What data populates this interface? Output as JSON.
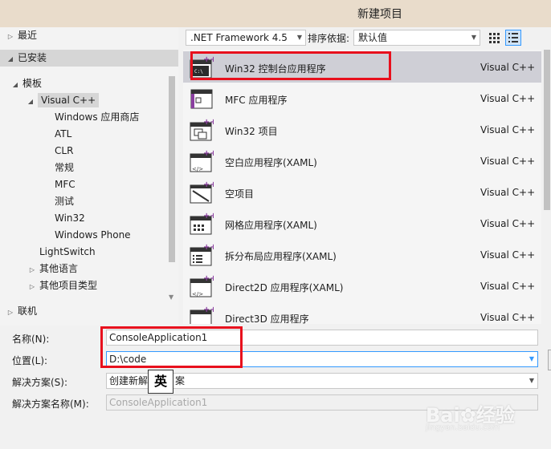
{
  "window": {
    "title": "新建项目"
  },
  "tree": {
    "recent": "最近",
    "installed": "已安装",
    "templates": "模板",
    "visual_cpp": "Visual C++",
    "children": [
      "Windows 应用商店",
      "ATL",
      "CLR",
      "常规",
      "MFC",
      "测试",
      "Win32",
      "Windows Phone"
    ],
    "lightswitch": "LightSwitch",
    "other_languages": "其他语言",
    "other_project_types": "其他项目类型",
    "online": "联机"
  },
  "toolbar": {
    "framework": ".NET Framework 4.5",
    "sort_label": "排序依据:",
    "sort_value": "默认值"
  },
  "templates": [
    {
      "name": "Win32 控制台应用程序",
      "lang": "Visual C++",
      "icon": "console-app-icon"
    },
    {
      "name": "MFC 应用程序",
      "lang": "Visual C++",
      "icon": "mfc-app-icon"
    },
    {
      "name": "Win32 项目",
      "lang": "Visual C++",
      "icon": "win32-project-icon"
    },
    {
      "name": "空白应用程序(XAML)",
      "lang": "Visual C++",
      "icon": "blank-app-icon"
    },
    {
      "name": "空项目",
      "lang": "Visual C++",
      "icon": "empty-project-icon"
    },
    {
      "name": "网格应用程序(XAML)",
      "lang": "Visual C++",
      "icon": "grid-app-icon"
    },
    {
      "name": "拆分布局应用程序(XAML)",
      "lang": "Visual C++",
      "icon": "split-app-icon"
    },
    {
      "name": "Direct2D 应用程序(XAML)",
      "lang": "Visual C++",
      "icon": "direct2d-app-icon"
    },
    {
      "name": "Direct3D 应用程序",
      "lang": "Visual C++",
      "icon": "direct3d-app-icon"
    }
  ],
  "form": {
    "name_label": "名称(N):",
    "name_value": "ConsoleApplication1",
    "location_label": "位置(L):",
    "location_value": "D:\\code",
    "solution_label": "解决方案(S):",
    "solution_value": "创建新解",
    "solution_value_tail": "案",
    "solution_name_label": "解决方案名称(M):",
    "solution_name_value": "ConsoleApplication1"
  },
  "ime": {
    "indicator": "英"
  },
  "watermark": {
    "brand": "Bai",
    "brand2": "经验",
    "url": "jingyan.baidu.com"
  },
  "colors": {
    "highlight_box": "#e8101d",
    "selection": "#cfcfd6",
    "accent": "#3399ff"
  }
}
